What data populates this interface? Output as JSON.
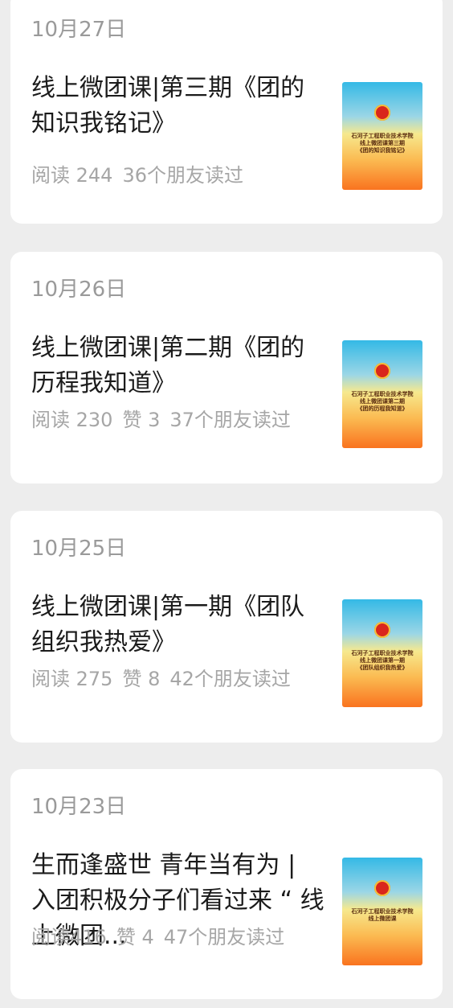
{
  "articles": [
    {
      "date": "10月27日",
      "title": "线上微团课|第三期《团的知识我铭记》",
      "reads": "阅读 244",
      "likes": "",
      "friends": "36个朋友读过",
      "thumb": {
        "line1": "石河子工程职业技术学院",
        "line2": "线上微团课第三期",
        "line3": "《团的知识我铭记》"
      }
    },
    {
      "date": "10月26日",
      "title": "线上微团课|第二期《团的历程我知道》",
      "reads": "阅读 230",
      "likes": "赞 3",
      "friends": "37个朋友读过",
      "thumb": {
        "line1": "石河子工程职业技术学院",
        "line2": "线上微团课第二期",
        "line3": "《团的历程我知道》"
      }
    },
    {
      "date": "10月25日",
      "title": "线上微团课|第一期《团队组织我热爱》",
      "reads": "阅读 275",
      "likes": "赞 8",
      "friends": "42个朋友读过",
      "thumb": {
        "line1": "石河子工程职业技术学院",
        "line2": "线上微团课第一期",
        "line3": "《团队组织我热爱》"
      }
    },
    {
      "date": "10月23日",
      "title": "生而逢盛世 青年当有为 | 入团积极分子们看过来 “ 线上微团...",
      "reads": "阅读416",
      "likes": "赞 4",
      "friends": "47个朋友读过",
      "thumb": {
        "line1": "石河子工程职业技术学院",
        "line2": "线上微团课",
        "line3": ""
      }
    }
  ]
}
